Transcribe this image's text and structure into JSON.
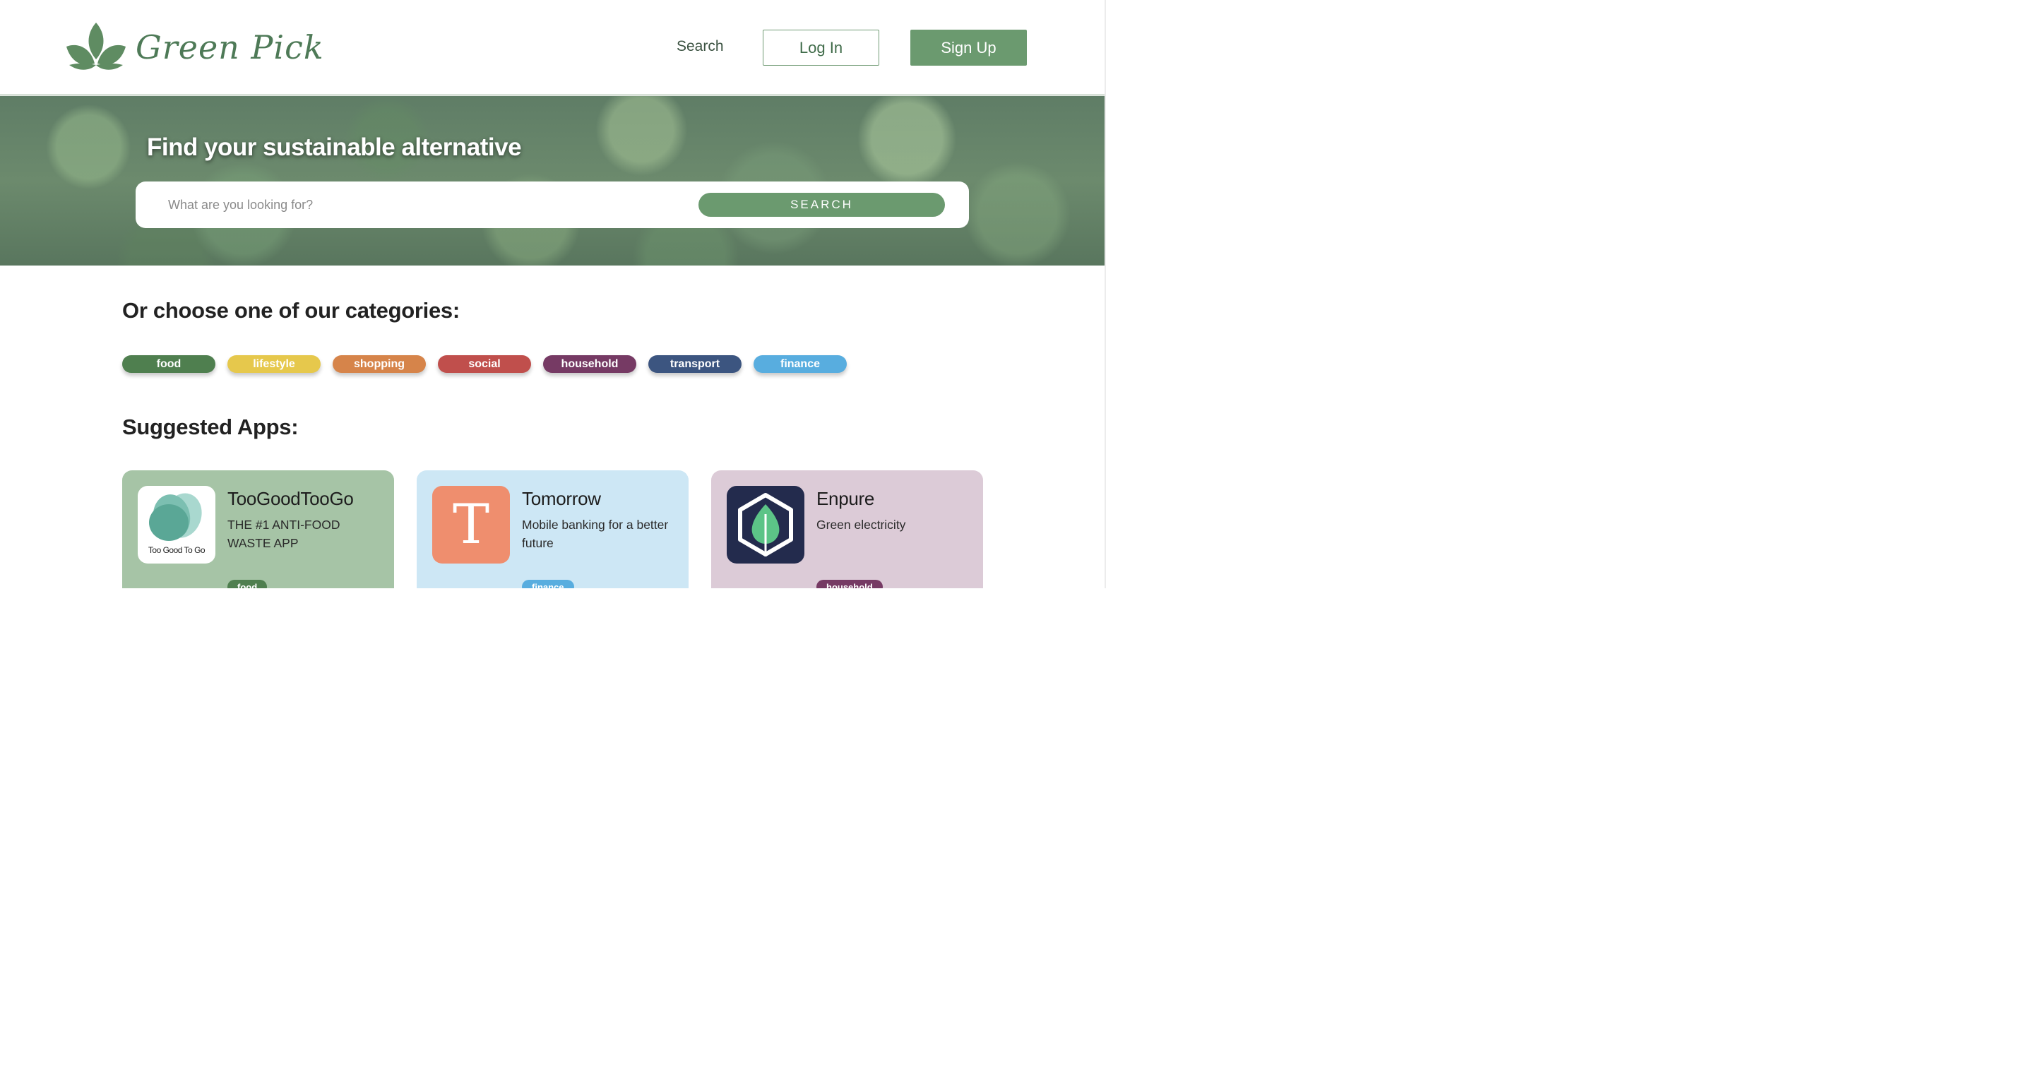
{
  "header": {
    "logo_text": "Green Pick",
    "nav_search": "Search",
    "login_label": "Log In",
    "signup_label": "Sign Up"
  },
  "hero": {
    "title": "Find your sustainable alternative",
    "search_placeholder": "What are you looking for?",
    "search_button": "SEARCH"
  },
  "categories": {
    "heading": "Or choose one of our categories:",
    "items": [
      {
        "label": "food",
        "color": "#4f7f4f"
      },
      {
        "label": "lifestyle",
        "color": "#e6c84c"
      },
      {
        "label": "shopping",
        "color": "#d6844a"
      },
      {
        "label": "social",
        "color": "#c04f4c"
      },
      {
        "label": "household",
        "color": "#763a64"
      },
      {
        "label": "transport",
        "color": "#3c5580"
      },
      {
        "label": "finance",
        "color": "#58addf"
      }
    ]
  },
  "apps": {
    "heading": "Suggested Apps:",
    "items": [
      {
        "name": "TooGoodTooGo",
        "description": "THE #1 ANTI-FOOD WASTE APP",
        "tag": "food",
        "icon_text": "Too Good To Go",
        "bg": "#a6c4a6",
        "tag_color": "#4f7f4f"
      },
      {
        "name": "Tomorrow",
        "description": "Mobile banking for a better future",
        "tag": "finance",
        "icon_text": "T",
        "bg": "#cde7f5",
        "tag_color": "#58addf"
      },
      {
        "name": "Enpure",
        "description": "Green electricity",
        "tag": "household",
        "icon_text": "",
        "bg": "#dccbd7",
        "tag_color": "#763a64"
      }
    ]
  },
  "colors": {
    "brand": "#6b9a6f",
    "brand_dark": "#4e7a57"
  }
}
